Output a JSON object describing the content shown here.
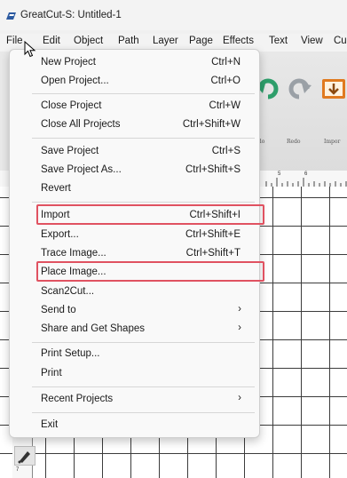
{
  "window": {
    "title": "GreatCut-S: Untitled-1"
  },
  "menubar": [
    "File",
    "Edit",
    "Object",
    "Path",
    "Layer",
    "Page",
    "Effects",
    "Text",
    "View",
    "Cu"
  ],
  "toolbar": {
    "undo_label": "ndo",
    "redo_label": "Redo",
    "import_label": "Impor"
  },
  "ruler": {
    "h_numbers": [
      "5",
      "6"
    ],
    "v_number": "7"
  },
  "file_menu": {
    "items": [
      {
        "label": "New Project",
        "shortcut": "Ctrl+N"
      },
      {
        "label": "Open Project...",
        "shortcut": "Ctrl+O"
      },
      {
        "label": "Close Project",
        "shortcut": "Ctrl+W"
      },
      {
        "label": "Close All Projects",
        "shortcut": "Ctrl+Shift+W"
      },
      {
        "label": "Save Project",
        "shortcut": "Ctrl+S"
      },
      {
        "label": "Save Project As...",
        "shortcut": "Ctrl+Shift+S"
      },
      {
        "label": "Revert",
        "shortcut": ""
      },
      {
        "label": "Import",
        "shortcut": "Ctrl+Shift+I"
      },
      {
        "label": "Export...",
        "shortcut": "Ctrl+Shift+E"
      },
      {
        "label": "Trace Image...",
        "shortcut": "Ctrl+Shift+T"
      },
      {
        "label": "Place Image...",
        "shortcut": ""
      },
      {
        "label": "Scan2Cut...",
        "shortcut": ""
      },
      {
        "label": "Send to",
        "shortcut": "",
        "arrow": "›"
      },
      {
        "label": "Share and Get Shapes",
        "shortcut": "",
        "arrow": "›"
      },
      {
        "label": "Print Setup...",
        "shortcut": ""
      },
      {
        "label": "Print",
        "shortcut": ""
      },
      {
        "label": "Recent Projects",
        "shortcut": "",
        "arrow": "›"
      },
      {
        "label": "Exit",
        "shortcut": ""
      }
    ],
    "highlighted": [
      "Import",
      "Place Image..."
    ]
  },
  "colors": {
    "highlight_border": "#e05261",
    "app_icon": "#2c5aa0",
    "toolbar_icon_green": "#2e9e6b",
    "toolbar_icon_orange": "#e07a1f"
  }
}
